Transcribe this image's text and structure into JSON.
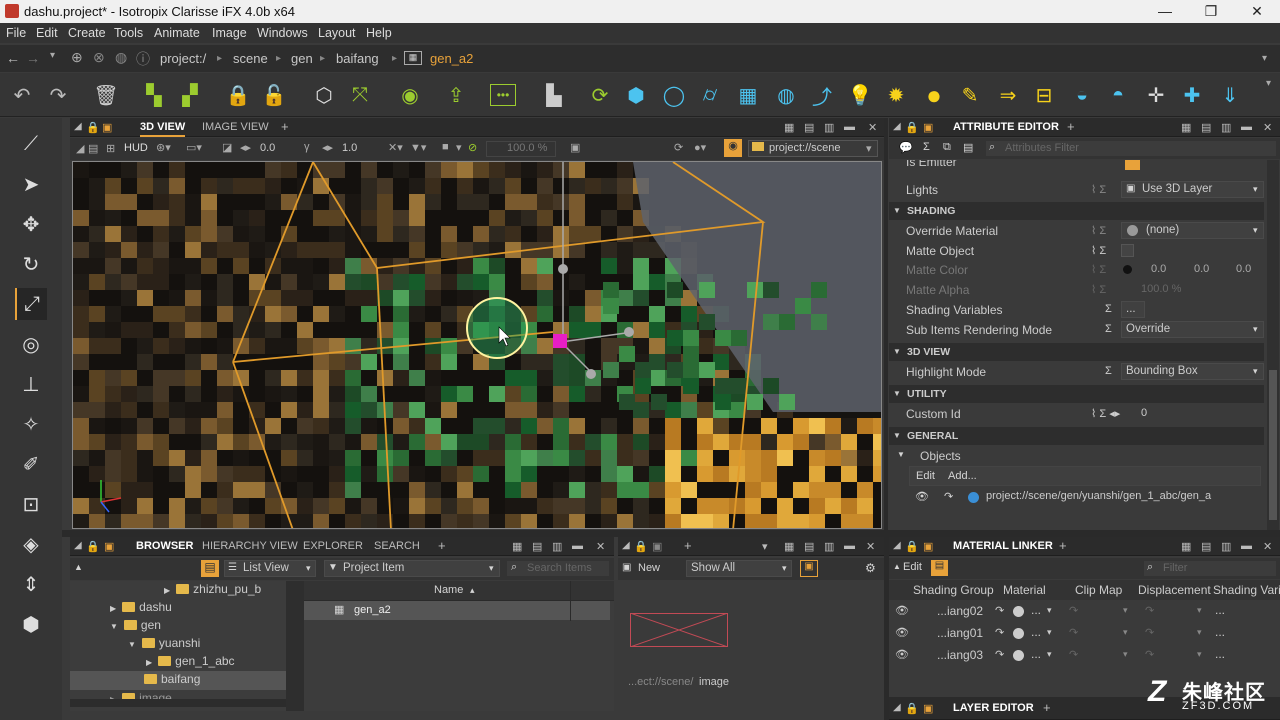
{
  "window": {
    "title": "dashu.project* - Isotropix Clarisse iFX 4.0b x64",
    "minimize": "—",
    "restore": "❐",
    "close": "✕"
  },
  "menu": [
    "File",
    "Edit",
    "Create",
    "Tools",
    "Animate",
    "Image",
    "Windows",
    "Layout",
    "Help"
  ],
  "path": {
    "items": [
      "project:/",
      "scene",
      "gen",
      "baifang"
    ],
    "current": "gen_a2",
    "accent": "#e8a23a"
  },
  "viewport": {
    "tabs": [
      "3D VIEW",
      "IMAGE VIEW"
    ],
    "hud": "HUD",
    "val1": "0.0",
    "val2": "1.0",
    "zoom": "100.0 %",
    "context": "project://scene"
  },
  "attribute_editor": {
    "title": "ATTRIBUTE EDITOR",
    "filter_placeholder": "Attributes Filter",
    "top_partial": "Is Emitter",
    "lights_label": "Lights",
    "lights_value": "Use 3D Layer",
    "sections": {
      "shading": "SHADING",
      "view3d": "3D VIEW",
      "utility": "UTILITY",
      "general": "GENERAL"
    },
    "override_material": {
      "label": "Override Material",
      "value": "(none)"
    },
    "matte_object": "Matte Object",
    "matte_color": {
      "label": "Matte Color",
      "r": "0.0",
      "g": "0.0",
      "b": "0.0"
    },
    "matte_alpha": {
      "label": "Matte Alpha",
      "value": "100.0 %"
    },
    "shading_variables": {
      "label": "Shading Variables",
      "value": "..."
    },
    "sub_items": {
      "label": "Sub Items Rendering Mode",
      "value": "Override"
    },
    "highlight_mode": {
      "label": "Highlight Mode",
      "value": "Bounding Box"
    },
    "custom_id": {
      "label": "Custom Id",
      "value": "0"
    },
    "objects": {
      "label": "Objects",
      "edit": "Edit",
      "add": "Add...",
      "item": "project://scene/gen/yuanshi/gen_1_abc/gen_a"
    }
  },
  "browser": {
    "tabs": [
      "BROWSER",
      "HIERARCHY VIEW",
      "EXPLORER",
      "SEARCH"
    ],
    "view_mode": "List View",
    "filter": "Project Item",
    "search_placeholder": "Search Items",
    "tree": [
      "zhizhu_pu_b",
      "dashu",
      "gen",
      "yuanshi",
      "gen_1_abc",
      "baifang",
      "image"
    ],
    "column": "Name",
    "item": "gen_a2"
  },
  "image_panel": {
    "new": "New",
    "show": "Show All",
    "caption_prefix": "...ect://scene/",
    "caption_name": "image"
  },
  "material_linker": {
    "title": "MATERIAL LINKER",
    "edit": "Edit",
    "filter_placeholder": "Filter",
    "columns": [
      "Shading Group",
      "Material",
      "Clip Map",
      "Displacement",
      "Shading Variab"
    ],
    "rows": [
      "...iang02",
      "...iang01",
      "...iang03"
    ],
    "dots": "..."
  },
  "layer_editor": {
    "title": "LAYER EDITOR"
  },
  "watermark": {
    "brand": "朱峰社区",
    "url": "ZF3D.COM"
  }
}
